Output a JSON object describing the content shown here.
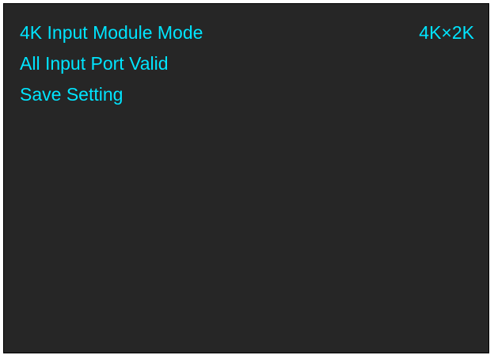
{
  "colors": {
    "background": "#262626",
    "text": "#00e5ff",
    "border": "#000000"
  },
  "menu": {
    "items": [
      {
        "label": "4K Input Module Mode",
        "value": "4K×2K"
      },
      {
        "label": "All Input Port Valid"
      },
      {
        "label": "Save Setting"
      }
    ]
  }
}
